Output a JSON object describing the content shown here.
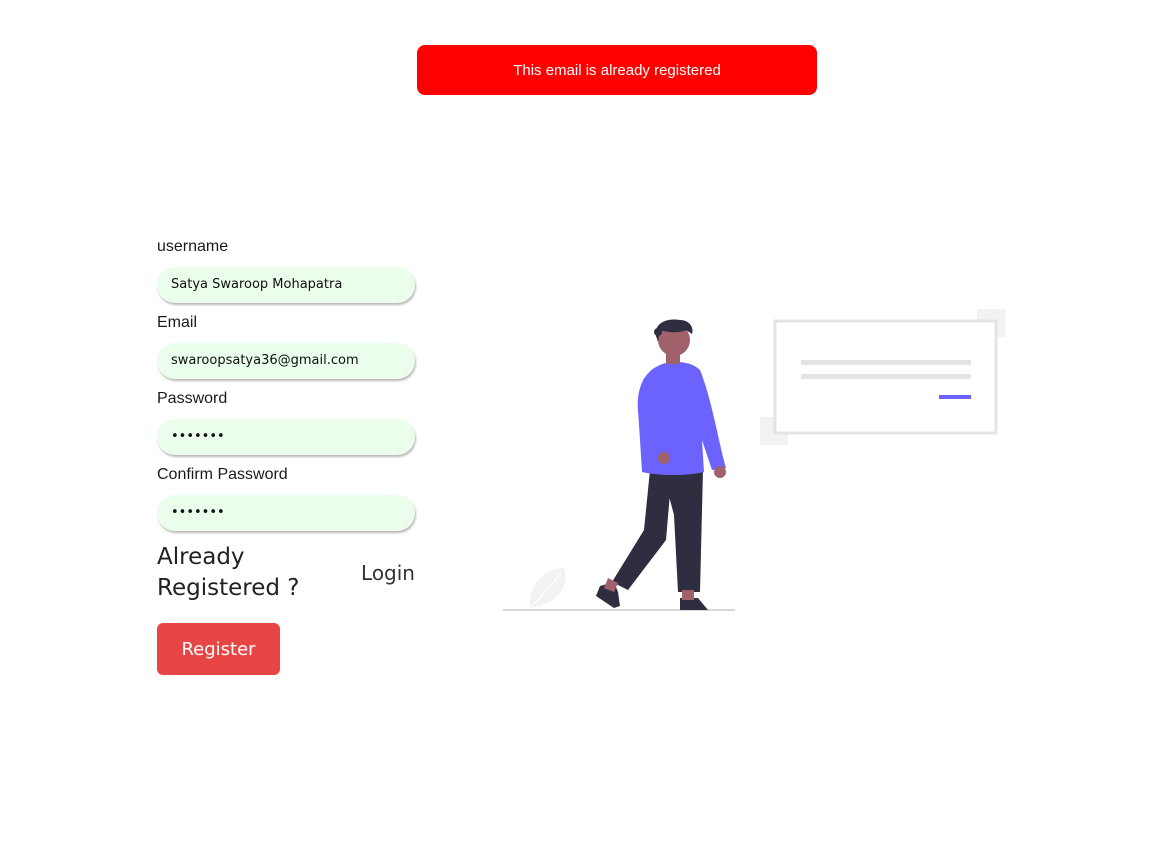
{
  "toast": {
    "message": "This email is already registered",
    "color": "#ff0000"
  },
  "form": {
    "username": {
      "label": "username",
      "value": "Satya Swaroop Mohapatra"
    },
    "email": {
      "label": "Email",
      "value": "swaroopsatya36@gmail.com"
    },
    "password": {
      "label": "Password",
      "value": "1234567"
    },
    "confirm_password": {
      "label": "Confirm Password",
      "value": "1234567"
    },
    "already_registered_text": "Already Registered ?",
    "login_label": "Login",
    "register_label": "Register",
    "input_background": "#ebfdeb",
    "register_color": "#e84545"
  },
  "illustration": {
    "accent_color": "#6c63ff",
    "skin_color": "#a0616a",
    "hair_color": "#2f2e41",
    "pants_color": "#2f2e41",
    "card_border_color": "#e4e4e4",
    "text_line_color": "#e4e4e4",
    "ground_color": "#cccccc"
  }
}
